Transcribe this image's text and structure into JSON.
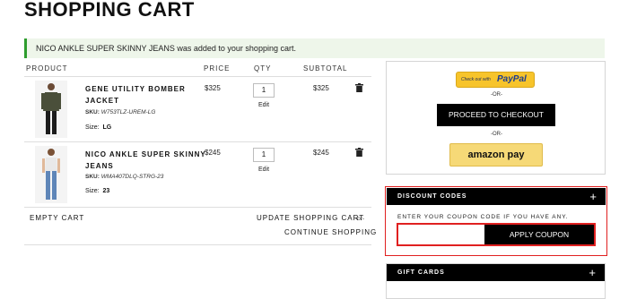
{
  "page": {
    "title": "SHOPPING CART"
  },
  "notice": {
    "text": "NICO ANKLE SUPER SKINNY JEANS was added to your shopping cart."
  },
  "table": {
    "headers": {
      "product": "PRODUCT",
      "price": "PRICE",
      "qty": "QTY",
      "subtotal": "SUBTOTAL"
    },
    "items": [
      {
        "name_line1": "GENE UTILITY BOMBER",
        "name_line2": "JACKET",
        "sku_label": "SKU:",
        "sku": "W753TLZ-UREM-LG",
        "size_label": "Size:",
        "size": "LG",
        "price": "$325",
        "qty": "1",
        "edit": "Edit",
        "subtotal": "$325"
      },
      {
        "name_line1": "NICO ANKLE SUPER SKINNY",
        "name_line2": "JEANS",
        "sku_label": "SKU:",
        "sku": "WMA407DLQ-STRG-23",
        "size_label": "Size:",
        "size": "23",
        "price": "$245",
        "qty": "1",
        "edit": "Edit",
        "subtotal": "$245"
      }
    ]
  },
  "actions": {
    "empty_cart": "EMPTY CART",
    "update_cart": "UPDATE SHOPPING CART",
    "or": "-or-",
    "continue": "CONTINUE SHOPPING"
  },
  "checkout": {
    "paypal_small": "Check out with",
    "paypal_brand": "PayPal",
    "or1": "-OR-",
    "proceed": "PROCEED TO CHECKOUT",
    "or2": "-OR-",
    "amazon": "amazon pay"
  },
  "discount": {
    "title": "DISCOUNT CODES",
    "toggle": "+",
    "prompt": "ENTER YOUR COUPON CODE IF YOU HAVE ANY.",
    "input_value": "",
    "apply": "APPLY COUPON"
  },
  "gift": {
    "title": "GIFT CARDS",
    "toggle": "+"
  },
  "colors": {
    "notice_bg": "#eef6ea",
    "notice_accent": "#2e9d2e",
    "paypal_bg": "#f7c42b",
    "amazon_bg": "#f6d977",
    "highlight": "#e02020"
  }
}
